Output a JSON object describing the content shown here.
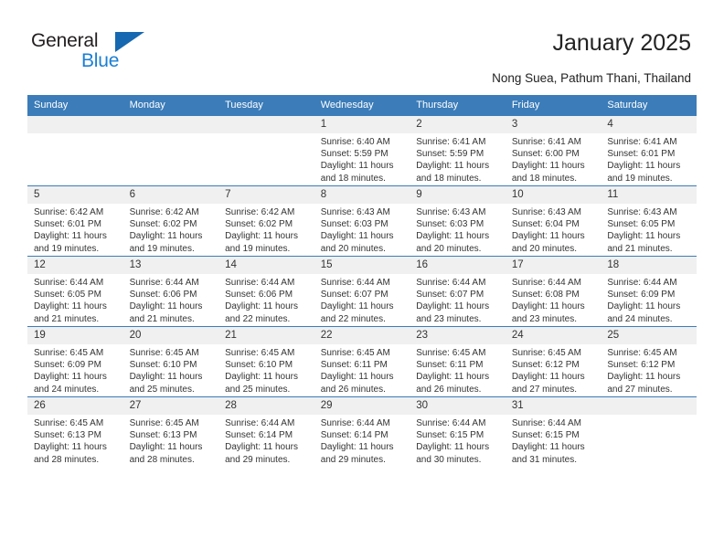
{
  "brand": {
    "name_top": "General",
    "name_bottom": "Blue",
    "triangle_color": "#1668b0",
    "blue_text_color": "#1a7fd4"
  },
  "header": {
    "title": "January 2025",
    "subtitle": "Nong Suea, Pathum Thani, Thailand"
  },
  "theme": {
    "header_bg": "#3b7cb9",
    "daynum_bg": "#f0f0f0",
    "row_border": "#3b7cb9"
  },
  "weekdays": [
    "Sunday",
    "Monday",
    "Tuesday",
    "Wednesday",
    "Thursday",
    "Friday",
    "Saturday"
  ],
  "weeks": [
    [
      {
        "day": "",
        "sunrise": "",
        "sunset": "",
        "daylight": "",
        "empty": true
      },
      {
        "day": "",
        "sunrise": "",
        "sunset": "",
        "daylight": "",
        "empty": true
      },
      {
        "day": "",
        "sunrise": "",
        "sunset": "",
        "daylight": "",
        "empty": true
      },
      {
        "day": "1",
        "sunrise": "Sunrise: 6:40 AM",
        "sunset": "Sunset: 5:59 PM",
        "daylight": "Daylight: 11 hours and 18 minutes."
      },
      {
        "day": "2",
        "sunrise": "Sunrise: 6:41 AM",
        "sunset": "Sunset: 5:59 PM",
        "daylight": "Daylight: 11 hours and 18 minutes."
      },
      {
        "day": "3",
        "sunrise": "Sunrise: 6:41 AM",
        "sunset": "Sunset: 6:00 PM",
        "daylight": "Daylight: 11 hours and 18 minutes."
      },
      {
        "day": "4",
        "sunrise": "Sunrise: 6:41 AM",
        "sunset": "Sunset: 6:01 PM",
        "daylight": "Daylight: 11 hours and 19 minutes."
      }
    ],
    [
      {
        "day": "5",
        "sunrise": "Sunrise: 6:42 AM",
        "sunset": "Sunset: 6:01 PM",
        "daylight": "Daylight: 11 hours and 19 minutes."
      },
      {
        "day": "6",
        "sunrise": "Sunrise: 6:42 AM",
        "sunset": "Sunset: 6:02 PM",
        "daylight": "Daylight: 11 hours and 19 minutes."
      },
      {
        "day": "7",
        "sunrise": "Sunrise: 6:42 AM",
        "sunset": "Sunset: 6:02 PM",
        "daylight": "Daylight: 11 hours and 19 minutes."
      },
      {
        "day": "8",
        "sunrise": "Sunrise: 6:43 AM",
        "sunset": "Sunset: 6:03 PM",
        "daylight": "Daylight: 11 hours and 20 minutes."
      },
      {
        "day": "9",
        "sunrise": "Sunrise: 6:43 AM",
        "sunset": "Sunset: 6:03 PM",
        "daylight": "Daylight: 11 hours and 20 minutes."
      },
      {
        "day": "10",
        "sunrise": "Sunrise: 6:43 AM",
        "sunset": "Sunset: 6:04 PM",
        "daylight": "Daylight: 11 hours and 20 minutes."
      },
      {
        "day": "11",
        "sunrise": "Sunrise: 6:43 AM",
        "sunset": "Sunset: 6:05 PM",
        "daylight": "Daylight: 11 hours and 21 minutes."
      }
    ],
    [
      {
        "day": "12",
        "sunrise": "Sunrise: 6:44 AM",
        "sunset": "Sunset: 6:05 PM",
        "daylight": "Daylight: 11 hours and 21 minutes."
      },
      {
        "day": "13",
        "sunrise": "Sunrise: 6:44 AM",
        "sunset": "Sunset: 6:06 PM",
        "daylight": "Daylight: 11 hours and 21 minutes."
      },
      {
        "day": "14",
        "sunrise": "Sunrise: 6:44 AM",
        "sunset": "Sunset: 6:06 PM",
        "daylight": "Daylight: 11 hours and 22 minutes."
      },
      {
        "day": "15",
        "sunrise": "Sunrise: 6:44 AM",
        "sunset": "Sunset: 6:07 PM",
        "daylight": "Daylight: 11 hours and 22 minutes."
      },
      {
        "day": "16",
        "sunrise": "Sunrise: 6:44 AM",
        "sunset": "Sunset: 6:07 PM",
        "daylight": "Daylight: 11 hours and 23 minutes."
      },
      {
        "day": "17",
        "sunrise": "Sunrise: 6:44 AM",
        "sunset": "Sunset: 6:08 PM",
        "daylight": "Daylight: 11 hours and 23 minutes."
      },
      {
        "day": "18",
        "sunrise": "Sunrise: 6:44 AM",
        "sunset": "Sunset: 6:09 PM",
        "daylight": "Daylight: 11 hours and 24 minutes."
      }
    ],
    [
      {
        "day": "19",
        "sunrise": "Sunrise: 6:45 AM",
        "sunset": "Sunset: 6:09 PM",
        "daylight": "Daylight: 11 hours and 24 minutes."
      },
      {
        "day": "20",
        "sunrise": "Sunrise: 6:45 AM",
        "sunset": "Sunset: 6:10 PM",
        "daylight": "Daylight: 11 hours and 25 minutes."
      },
      {
        "day": "21",
        "sunrise": "Sunrise: 6:45 AM",
        "sunset": "Sunset: 6:10 PM",
        "daylight": "Daylight: 11 hours and 25 minutes."
      },
      {
        "day": "22",
        "sunrise": "Sunrise: 6:45 AM",
        "sunset": "Sunset: 6:11 PM",
        "daylight": "Daylight: 11 hours and 26 minutes."
      },
      {
        "day": "23",
        "sunrise": "Sunrise: 6:45 AM",
        "sunset": "Sunset: 6:11 PM",
        "daylight": "Daylight: 11 hours and 26 minutes."
      },
      {
        "day": "24",
        "sunrise": "Sunrise: 6:45 AM",
        "sunset": "Sunset: 6:12 PM",
        "daylight": "Daylight: 11 hours and 27 minutes."
      },
      {
        "day": "25",
        "sunrise": "Sunrise: 6:45 AM",
        "sunset": "Sunset: 6:12 PM",
        "daylight": "Daylight: 11 hours and 27 minutes."
      }
    ],
    [
      {
        "day": "26",
        "sunrise": "Sunrise: 6:45 AM",
        "sunset": "Sunset: 6:13 PM",
        "daylight": "Daylight: 11 hours and 28 minutes."
      },
      {
        "day": "27",
        "sunrise": "Sunrise: 6:45 AM",
        "sunset": "Sunset: 6:13 PM",
        "daylight": "Daylight: 11 hours and 28 minutes."
      },
      {
        "day": "28",
        "sunrise": "Sunrise: 6:44 AM",
        "sunset": "Sunset: 6:14 PM",
        "daylight": "Daylight: 11 hours and 29 minutes."
      },
      {
        "day": "29",
        "sunrise": "Sunrise: 6:44 AM",
        "sunset": "Sunset: 6:14 PM",
        "daylight": "Daylight: 11 hours and 29 minutes."
      },
      {
        "day": "30",
        "sunrise": "Sunrise: 6:44 AM",
        "sunset": "Sunset: 6:15 PM",
        "daylight": "Daylight: 11 hours and 30 minutes."
      },
      {
        "day": "31",
        "sunrise": "Sunrise: 6:44 AM",
        "sunset": "Sunset: 6:15 PM",
        "daylight": "Daylight: 11 hours and 31 minutes."
      },
      {
        "day": "",
        "sunrise": "",
        "sunset": "",
        "daylight": "",
        "empty": true
      }
    ]
  ]
}
